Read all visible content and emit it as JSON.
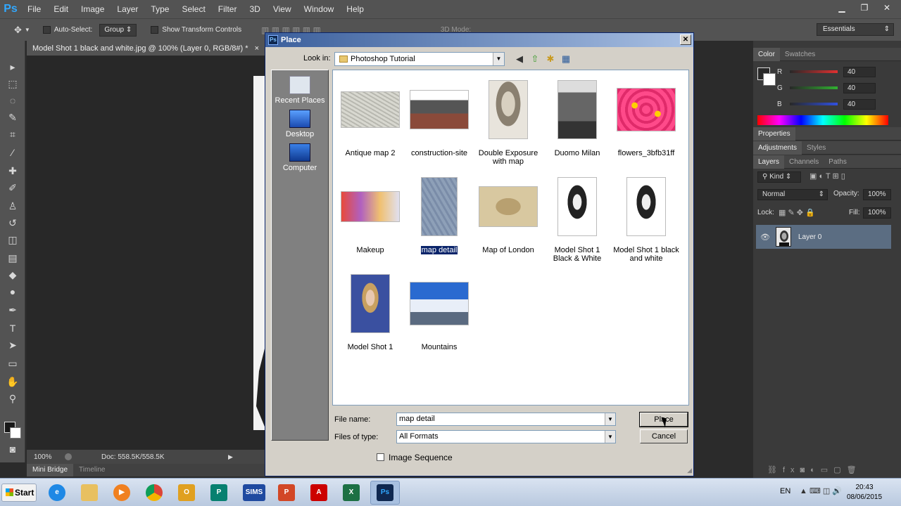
{
  "app": {
    "logo": "Ps",
    "menu": [
      "File",
      "Edit",
      "Image",
      "Layer",
      "Type",
      "Select",
      "Filter",
      "3D",
      "View",
      "Window",
      "Help"
    ],
    "window_controls": [
      "▁",
      "❐",
      "✕"
    ]
  },
  "options_bar": {
    "auto_select_label": "Auto-Select:",
    "auto_select_value": "Group",
    "transform_label": "Show Transform Controls",
    "mode_label": "3D Mode:",
    "workspace": "Essentials"
  },
  "document": {
    "tab_title": "Model Shot 1 black and white.jpg @ 100% (Layer 0, RGB/8#) *",
    "zoom": "100%",
    "doc_info": "Doc: 558.5K/558.5K"
  },
  "bottom_tabs": [
    "Mini Bridge",
    "Timeline"
  ],
  "color_panel": {
    "tabs": [
      "Color",
      "Swatches"
    ],
    "channels": [
      {
        "label": "R",
        "value": "40",
        "color": "#e03030"
      },
      {
        "label": "G",
        "value": "40",
        "color": "#30b030"
      },
      {
        "label": "B",
        "value": "40",
        "color": "#3050e0"
      }
    ]
  },
  "properties_tab": "Properties",
  "adjustments_tabs": [
    "Adjustments",
    "Styles"
  ],
  "layers_panel": {
    "tabs": [
      "Layers",
      "Channels",
      "Paths"
    ],
    "kind_label": "Kind",
    "blend_mode": "Normal",
    "opacity_label": "Opacity:",
    "opacity_value": "100%",
    "lock_label": "Lock:",
    "fill_label": "Fill:",
    "fill_value": "100%",
    "layer_name": "Layer 0"
  },
  "dialog": {
    "title": "Place",
    "title_icon": "Ps",
    "look_in_label": "Look in:",
    "look_in_value": "Photoshop Tutorial",
    "places": [
      "Recent Places",
      "Desktop",
      "Computer"
    ],
    "files": [
      {
        "name": "Antique map 2"
      },
      {
        "name": "construction-site"
      },
      {
        "name": "Double Exposure with map"
      },
      {
        "name": "Duomo Milan"
      },
      {
        "name": "flowers_3bfb31ff"
      },
      {
        "name": "Makeup"
      },
      {
        "name": "map detail",
        "selected": true
      },
      {
        "name": "Map of London"
      },
      {
        "name": "Model Shot 1 Black & White"
      },
      {
        "name": "Model Shot 1 black and white"
      },
      {
        "name": "Model Shot 1"
      },
      {
        "name": "Mountains"
      }
    ],
    "file_name_label": "File name:",
    "file_name_value": "map detail",
    "file_type_label": "Files of type:",
    "file_type_value": "All Formats",
    "place_button": "Place",
    "cancel_button": "Cancel",
    "image_sequence_label": "Image Sequence"
  },
  "taskbar": {
    "start_label": "Start",
    "sims_label": "SIMS",
    "language": "EN",
    "time": "20:43",
    "date": "08/06/2015"
  }
}
